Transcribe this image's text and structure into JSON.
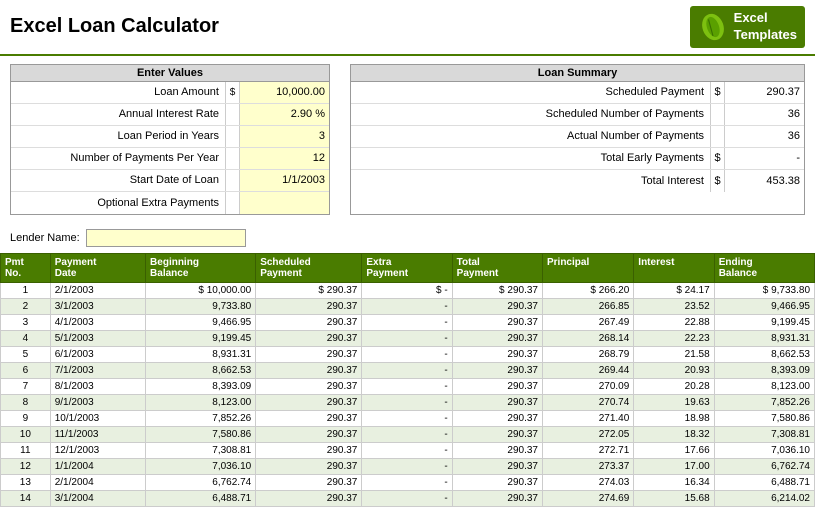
{
  "header": {
    "title": "Excel Loan Calculator",
    "logo_line1": "Excel",
    "logo_line2": "Templates"
  },
  "enter_values": {
    "heading": "Enter Values",
    "fields": [
      {
        "label": "Loan Amount",
        "currency": "$",
        "value": "10,000.00"
      },
      {
        "label": "Annual Interest Rate",
        "currency": "",
        "value": "2.90  %"
      },
      {
        "label": "Loan Period in Years",
        "currency": "",
        "value": "3"
      },
      {
        "label": "Number of Payments Per Year",
        "currency": "",
        "value": "12"
      },
      {
        "label": "Start Date of Loan",
        "currency": "",
        "value": "1/1/2003"
      },
      {
        "label": "Optional Extra Payments",
        "currency": "",
        "value": ""
      }
    ]
  },
  "loan_summary": {
    "heading": "Loan Summary",
    "fields": [
      {
        "label": "Scheduled Payment",
        "currency": "$",
        "value": "290.37"
      },
      {
        "label": "Scheduled Number of Payments",
        "currency": "",
        "value": "36"
      },
      {
        "label": "Actual Number of Payments",
        "currency": "",
        "value": "36"
      },
      {
        "label": "Total Early Payments",
        "currency": "$",
        "value": "-"
      },
      {
        "label": "Total Interest",
        "currency": "$",
        "value": "453.38"
      }
    ]
  },
  "lender": {
    "label": "Lender Name:",
    "value": ""
  },
  "table": {
    "columns": [
      {
        "key": "pmt_no",
        "label": "Pmt\nNo."
      },
      {
        "key": "payment_date",
        "label": "Payment\nDate"
      },
      {
        "key": "beg_balance",
        "label": "Beginning\nBalance"
      },
      {
        "key": "sched_payment",
        "label": "Scheduled\nPayment"
      },
      {
        "key": "extra_payment",
        "label": "Extra\nPayment"
      },
      {
        "key": "total_payment",
        "label": "Total\nPayment"
      },
      {
        "key": "principal",
        "label": "Principal"
      },
      {
        "key": "interest",
        "label": "Interest"
      },
      {
        "key": "ending_balance",
        "label": "Ending\nBalance"
      }
    ],
    "rows": [
      {
        "pmt_no": "1",
        "payment_date": "2/1/2003",
        "beg_balance": "$ 10,000.00",
        "sched_payment": "$ 290.37",
        "extra_payment": "$ -",
        "total_payment": "$ 290.37",
        "principal": "$ 266.20",
        "interest": "$ 24.17",
        "ending_balance": "$ 9,733.80"
      },
      {
        "pmt_no": "2",
        "payment_date": "3/1/2003",
        "beg_balance": "9,733.80",
        "sched_payment": "290.37",
        "extra_payment": "-",
        "total_payment": "290.37",
        "principal": "266.85",
        "interest": "23.52",
        "ending_balance": "9,466.95"
      },
      {
        "pmt_no": "3",
        "payment_date": "4/1/2003",
        "beg_balance": "9,466.95",
        "sched_payment": "290.37",
        "extra_payment": "-",
        "total_payment": "290.37",
        "principal": "267.49",
        "interest": "22.88",
        "ending_balance": "9,199.45"
      },
      {
        "pmt_no": "4",
        "payment_date": "5/1/2003",
        "beg_balance": "9,199.45",
        "sched_payment": "290.37",
        "extra_payment": "-",
        "total_payment": "290.37",
        "principal": "268.14",
        "interest": "22.23",
        "ending_balance": "8,931.31"
      },
      {
        "pmt_no": "5",
        "payment_date": "6/1/2003",
        "beg_balance": "8,931.31",
        "sched_payment": "290.37",
        "extra_payment": "-",
        "total_payment": "290.37",
        "principal": "268.79",
        "interest": "21.58",
        "ending_balance": "8,662.53"
      },
      {
        "pmt_no": "6",
        "payment_date": "7/1/2003",
        "beg_balance": "8,662.53",
        "sched_payment": "290.37",
        "extra_payment": "-",
        "total_payment": "290.37",
        "principal": "269.44",
        "interest": "20.93",
        "ending_balance": "8,393.09"
      },
      {
        "pmt_no": "7",
        "payment_date": "8/1/2003",
        "beg_balance": "8,393.09",
        "sched_payment": "290.37",
        "extra_payment": "-",
        "total_payment": "290.37",
        "principal": "270.09",
        "interest": "20.28",
        "ending_balance": "8,123.00"
      },
      {
        "pmt_no": "8",
        "payment_date": "9/1/2003",
        "beg_balance": "8,123.00",
        "sched_payment": "290.37",
        "extra_payment": "-",
        "total_payment": "290.37",
        "principal": "270.74",
        "interest": "19.63",
        "ending_balance": "7,852.26"
      },
      {
        "pmt_no": "9",
        "payment_date": "10/1/2003",
        "beg_balance": "7,852.26",
        "sched_payment": "290.37",
        "extra_payment": "-",
        "total_payment": "290.37",
        "principal": "271.40",
        "interest": "18.98",
        "ending_balance": "7,580.86"
      },
      {
        "pmt_no": "10",
        "payment_date": "11/1/2003",
        "beg_balance": "7,580.86",
        "sched_payment": "290.37",
        "extra_payment": "-",
        "total_payment": "290.37",
        "principal": "272.05",
        "interest": "18.32",
        "ending_balance": "7,308.81"
      },
      {
        "pmt_no": "11",
        "payment_date": "12/1/2003",
        "beg_balance": "7,308.81",
        "sched_payment": "290.37",
        "extra_payment": "-",
        "total_payment": "290.37",
        "principal": "272.71",
        "interest": "17.66",
        "ending_balance": "7,036.10"
      },
      {
        "pmt_no": "12",
        "payment_date": "1/1/2004",
        "beg_balance": "7,036.10",
        "sched_payment": "290.37",
        "extra_payment": "-",
        "total_payment": "290.37",
        "principal": "273.37",
        "interest": "17.00",
        "ending_balance": "6,762.74"
      },
      {
        "pmt_no": "13",
        "payment_date": "2/1/2004",
        "beg_balance": "6,762.74",
        "sched_payment": "290.37",
        "extra_payment": "-",
        "total_payment": "290.37",
        "principal": "274.03",
        "interest": "16.34",
        "ending_balance": "6,488.71"
      },
      {
        "pmt_no": "14",
        "payment_date": "3/1/2004",
        "beg_balance": "6,488.71",
        "sched_payment": "290.37",
        "extra_payment": "-",
        "total_payment": "290.37",
        "principal": "274.69",
        "interest": "15.68",
        "ending_balance": "6,214.02"
      }
    ]
  }
}
